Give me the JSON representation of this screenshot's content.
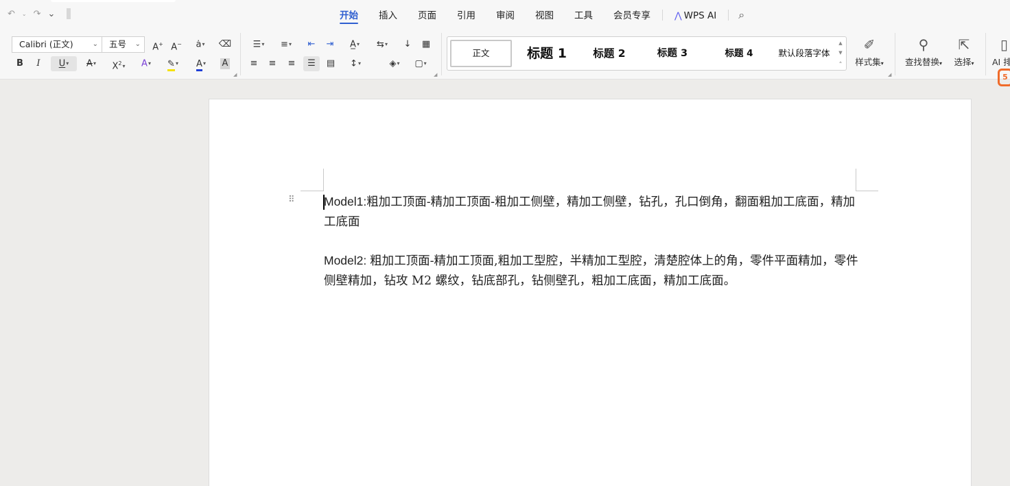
{
  "menubar": {
    "tabs": [
      {
        "label": "开始",
        "active": true
      },
      {
        "label": "插入"
      },
      {
        "label": "页面"
      },
      {
        "label": "引用"
      },
      {
        "label": "审阅"
      },
      {
        "label": "视图"
      },
      {
        "label": "工具"
      },
      {
        "label": "会员专享"
      },
      {
        "label": "WPS AI"
      }
    ]
  },
  "ribbon": {
    "font_name": "Calibri (正文)",
    "font_size": "五号",
    "styles": {
      "normal": "正文",
      "heading1": "标题 1",
      "heading2": "标题 2",
      "heading3": "标题 3",
      "heading4": "标题 4",
      "default_para_font": "默认段落字体"
    },
    "style_set_label": "样式集",
    "find_replace_label": "查找替换",
    "select_label": "选择",
    "ai_label": "AI 排"
  },
  "document": {
    "paragraph1": {
      "prefix": "Model1:",
      "text": "粗加工顶面-精加工顶面-粗加工侧壁，精加工侧壁，钻孔，孔口倒角，翻面粗加工底面，精加工底面"
    },
    "paragraph2": {
      "prefix": "Model2: ",
      "text": "粗加工顶面-精加工顶面,粗加工型腔，半精加工型腔，清楚腔体上的角，零件平面精加，零件侧壁精加，钻攻 M2 螺纹，钻底部孔，钻侧壁孔，粗加工底面，精加工底面。"
    }
  },
  "colors": {
    "accent": "#2f5fd0",
    "highlight_yellow": "#f5e100",
    "font_color_blue": "#1f3fd6",
    "brand_orange": "#f06b2a"
  }
}
